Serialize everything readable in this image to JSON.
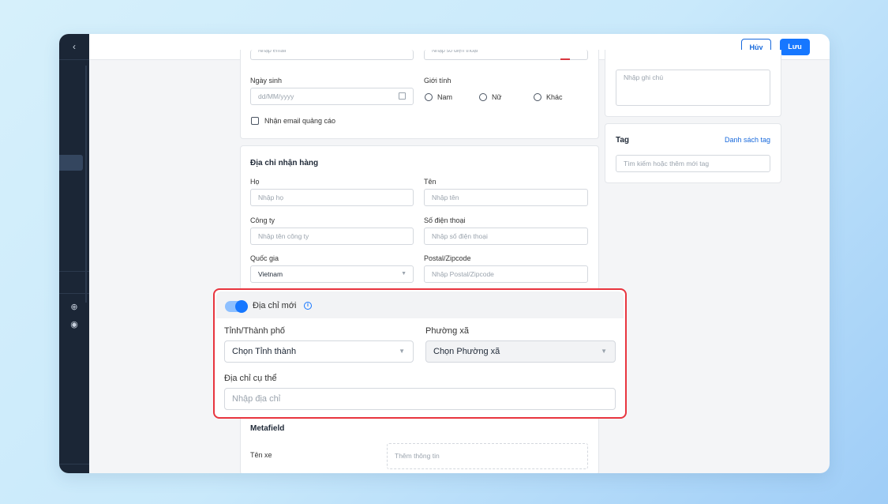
{
  "toolbar": {
    "cancel_label": "Hủy",
    "save_label": "Lưu"
  },
  "sidebar": {
    "collapse_icon": "chevron-left-icon"
  },
  "contact": {
    "email_placeholder": "Nhập email",
    "phone_placeholder": "Nhập số điện thoại",
    "birthday_label": "Ngày sinh",
    "birthday_placeholder": "dd/MM/yyyy",
    "gender_label": "Giới tính",
    "gender_options": [
      "Nam",
      "Nữ",
      "Khác"
    ],
    "marketing_label": "Nhận email quảng cáo"
  },
  "shipping": {
    "title": "Địa chỉ nhận hàng",
    "last_name_label": "Họ",
    "last_name_placeholder": "Nhập họ",
    "first_name_label": "Tên",
    "first_name_placeholder": "Nhập tên",
    "company_label": "Công ty",
    "company_placeholder": "Nhập tên công ty",
    "phone_label": "Số điện thoại",
    "phone_placeholder": "Nhập số điện thoại",
    "country_label": "Quốc gia",
    "country_value": "Vietnam",
    "postal_label": "Postal/Zipcode",
    "postal_placeholder": "Nhập Postal/Zipcode"
  },
  "new_address": {
    "toggle_label": "Địa chỉ mới",
    "province_label": "Tỉnh/Thành phố",
    "province_value": "Chọn Tỉnh thành",
    "ward_label": "Phường xã",
    "ward_value": "Chọn Phường xã",
    "detail_label": "Địa chỉ cụ thể",
    "detail_placeholder": "Nhập địa chỉ"
  },
  "metafield": {
    "title": "Metafield",
    "car_label": "Tên xe",
    "car_placeholder": "Thêm thông tin"
  },
  "note": {
    "placeholder": "Nhập ghi chú"
  },
  "tag": {
    "title": "Tag",
    "list_link": "Danh sách tag",
    "search_placeholder": "Tìm kiếm hoặc thêm mới tag"
  },
  "colors": {
    "accent": "#1677ff",
    "highlight": "#e8353f",
    "sidebar": "#1b2636"
  }
}
